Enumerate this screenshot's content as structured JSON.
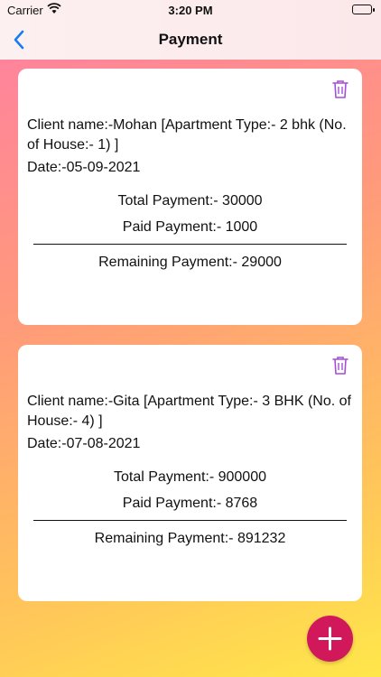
{
  "status_bar": {
    "carrier": "Carrier",
    "time": "3:20 PM"
  },
  "nav": {
    "title": "Payment"
  },
  "cards": [
    {
      "client": "Client name:-Mohan [Apartment Type:- 2 bhk (No. of House:- 1) ]",
      "date": "Date:-05-09-2021",
      "total": "Total Payment:- 30000",
      "paid": "Paid Payment:- 1000",
      "remaining": "Remaining Payment:- 29000"
    },
    {
      "client": "Client name:-Gita [Apartment Type:- 3 BHK (No. of House:- 4) ]",
      "date": "Date:-07-08-2021",
      "total": "Total Payment:- 900000",
      "paid": "Paid Payment:- 8768",
      "remaining": "Remaining Payment:- 891232"
    }
  ],
  "colors": {
    "accent": "#1a7cf5",
    "fab": "#d0185a",
    "trash": "#a64fd6"
  },
  "icons": {
    "back": "chevron-left-icon",
    "trash": "trash-icon",
    "add": "plus-icon"
  }
}
